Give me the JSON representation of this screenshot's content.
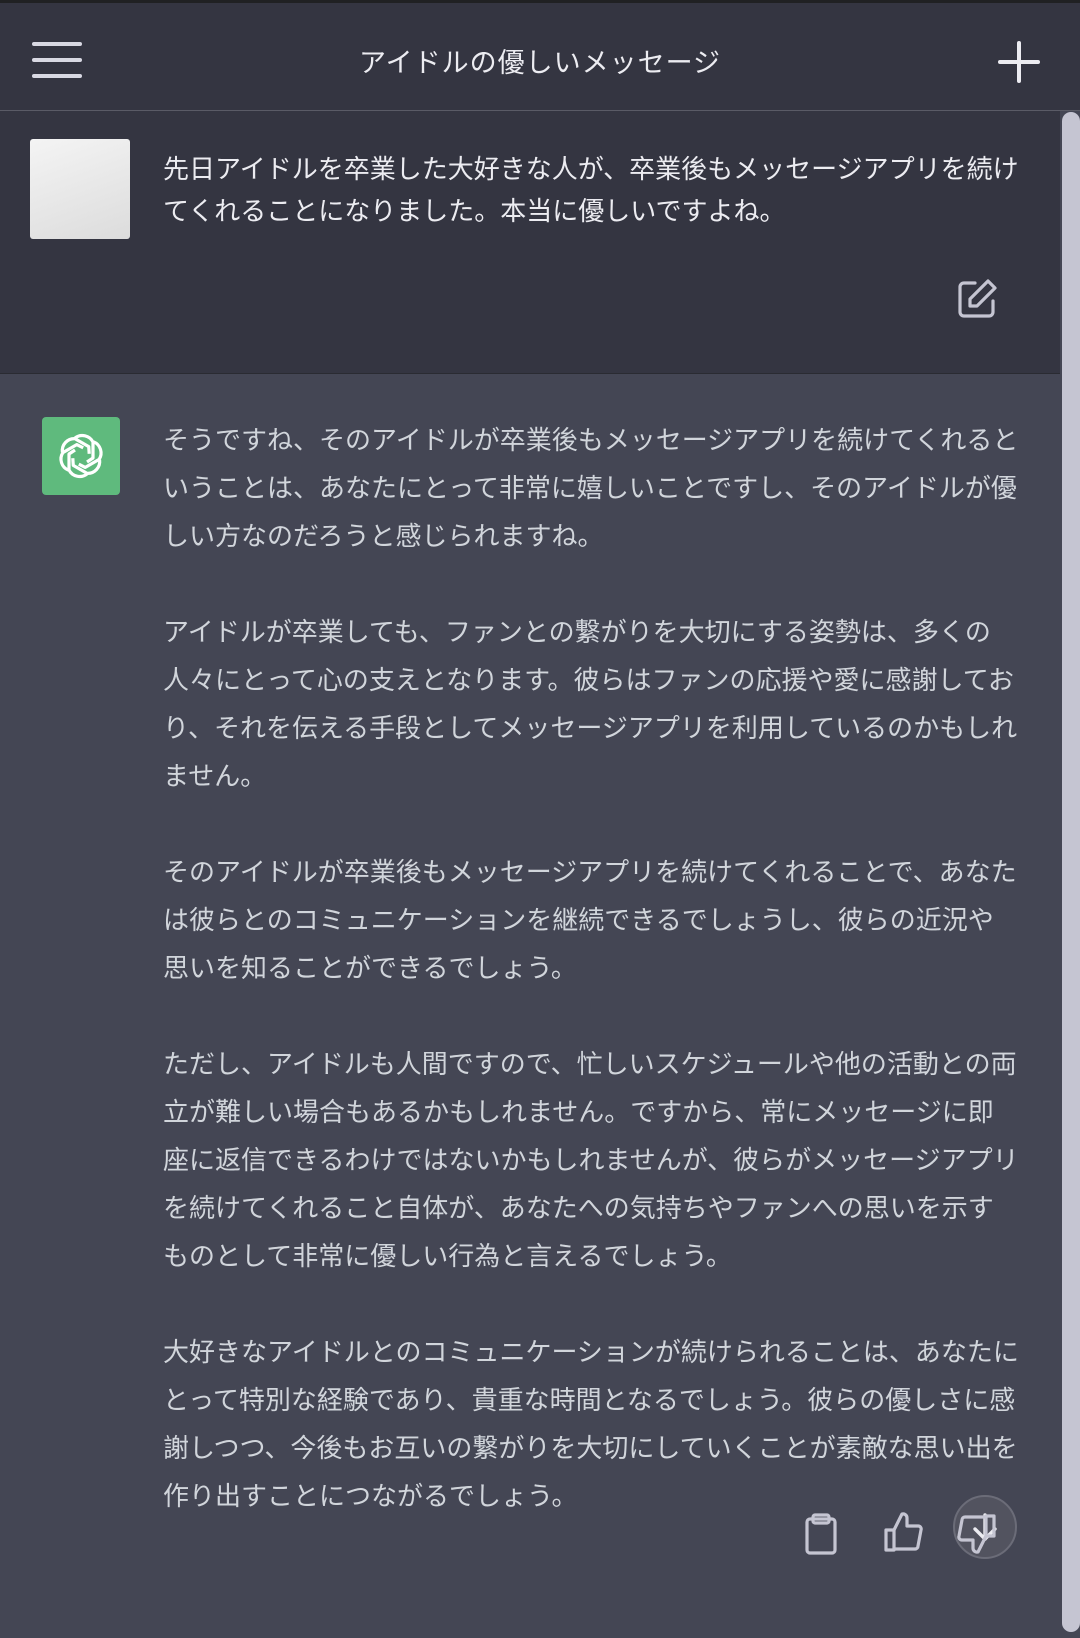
{
  "header": {
    "title": "アイドルの優しいメッセージ",
    "menu_icon": "hamburger-menu-icon",
    "new_chat_icon": "plus-icon"
  },
  "user_message": {
    "text": "先日アイドルを卒業した大好きな人が、卒業後もメッセージアプリを続けてくれることになりました。本当に優しいですよね。",
    "edit_icon": "edit-icon"
  },
  "assistant_message": {
    "avatar_icon": "openai-logo-icon",
    "paragraphs": [
      "そうですね、そのアイドルが卒業後もメッセージアプリを続けてくれるということは、あなたにとって非常に嬉しいことですし、そのアイドルが優しい方なのだろうと感じられますね。",
      "アイドルが卒業しても、ファンとの繋がりを大切にする姿勢は、多くの人々にとって心の支えとなります。彼らはファンの応援や愛に感謝しており、それを伝える手段としてメッセージアプリを利用しているのかもしれません。",
      "そのアイドルが卒業後もメッセージアプリを続けてくれることで、あなたは彼らとのコミュニケーションを継続できるでしょうし、彼らの近況や思いを知ることができるでしょう。",
      "ただし、アイドルも人間ですので、忙しいスケジュールや他の活動との両立が難しい場合もあるかもしれません。ですから、常にメッセージに即座に返信できるわけではないかもしれませんが、彼らがメッセージアプリを続けてくれること自体が、あなたへの気持ちやファンへの思いを示すものとして非常に優しい行為と言えるでしょう。",
      "大好きなアイドルとのコミュニケーションが続けられることは、あなたにとって特別な経験であり、貴重な時間となるでしょう。彼らの優しさに感謝しつつ、今後もお互いの繋がりを大切にしていくことが素敵な思い出を作り出すことにつながるでしょう。"
    ],
    "actions": {
      "copy_icon": "clipboard-icon",
      "like_icon": "thumbs-up-icon",
      "dislike_icon": "thumbs-down-icon"
    },
    "scroll_icon": "arrow-down-icon"
  },
  "colors": {
    "header_bg": "#343541",
    "user_bg": "#343541",
    "assistant_bg": "#444654",
    "accent_green": "#5fba7d"
  }
}
